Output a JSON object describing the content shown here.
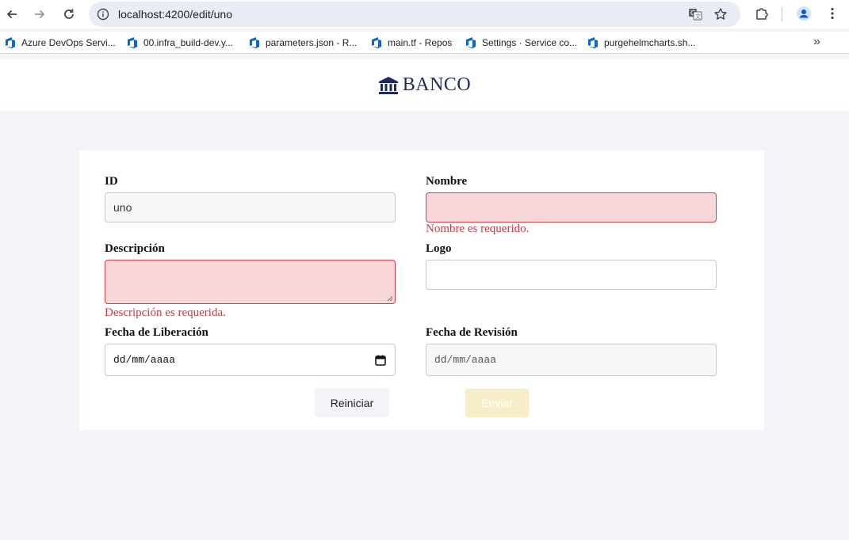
{
  "browser": {
    "url": "localhost:4200/edit/uno",
    "bookmarks": [
      {
        "label": "Azure DevOps Servi..."
      },
      {
        "label": "00.infra_build-dev.y..."
      },
      {
        "label": "parameters.json - R..."
      },
      {
        "label": "main.tf - Repos"
      },
      {
        "label": "Settings · Service co..."
      },
      {
        "label": "purgehelmcharts.sh..."
      }
    ],
    "more_label": "»",
    "icons": [
      "back-icon",
      "forward-icon",
      "reload-icon",
      "info-icon",
      "translate-icon",
      "star-icon",
      "extensions-icon",
      "profile-icon",
      "menu-icon",
      "azure-devops-icon"
    ]
  },
  "header": {
    "brand": "BANCO",
    "logo_icon": "bank-icon"
  },
  "form": {
    "id": {
      "label": "ID",
      "value": "uno"
    },
    "nombre": {
      "label": "Nombre",
      "value": "",
      "error": "Nombre es requerido."
    },
    "descripcion": {
      "label": "Descripción",
      "value": "",
      "error": "Descripción es requerida."
    },
    "logo": {
      "label": "Logo",
      "value": ""
    },
    "fecha_liberacion": {
      "label": "Fecha de Liberación",
      "placeholder": "dd/mm/aaaa"
    },
    "fecha_revision": {
      "label": "Fecha de Revisión",
      "placeholder": "dd/mm/aaaa"
    },
    "reset_label": "Reiniciar",
    "submit_label": "Enviar"
  },
  "colors": {
    "page_bg": "#f3f4f8",
    "brand": "#1f2c5a",
    "error": "#c63a44",
    "invalid_bg": "#f8d7da",
    "submit_disabled_bg": "#f7edc6"
  }
}
